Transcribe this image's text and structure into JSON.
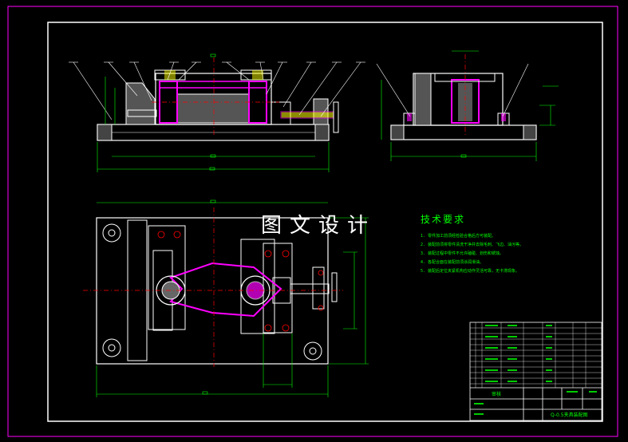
{
  "watermark": "图文设计",
  "tech_requirements": {
    "title": "技术要求",
    "notes": [
      "1. 零件加工前须经检验合格后方可装配。",
      "2. 装配前须将零件清洗干净并去除毛刺、飞边、油污等。",
      "3. 装配过程中零件不允许磕碰、划伤和锈蚀。",
      "4. 各配合面在装配前须涂润滑油。",
      "5. 装配后定位夹紧机构应动作灵活可靠，无卡滞现象。"
    ]
  },
  "title_block": {
    "label_left": "审核",
    "drawing_name": "Q-0.5夹具装配图"
  },
  "colors": {
    "background": "#000000",
    "outline": "#ffffff",
    "dimension": "#00ff00",
    "section": "#ff00ff",
    "centerline": "#ff0000",
    "hatch": "#ffff00"
  }
}
